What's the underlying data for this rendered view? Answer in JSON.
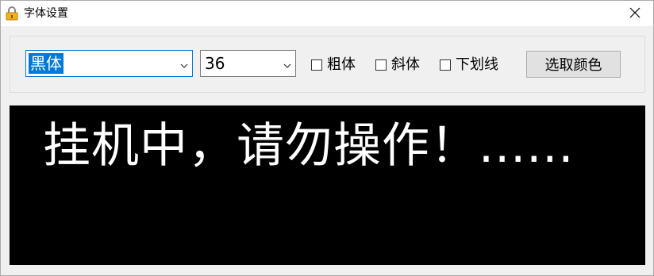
{
  "window": {
    "title": "字体设置",
    "icons": {
      "app": "lock-icon",
      "close": "close-icon"
    }
  },
  "toolbar": {
    "font_value": "黑体",
    "size_value": "36",
    "bold_label": "粗体",
    "italic_label": "斜体",
    "underline_label": "下划线",
    "bold_checked": false,
    "italic_checked": false,
    "underline_checked": false,
    "color_button_label": "选取颜色"
  },
  "preview": {
    "text": "挂机中，请勿操作！......",
    "text_color": "#ffffff",
    "background_color": "#000000"
  }
}
